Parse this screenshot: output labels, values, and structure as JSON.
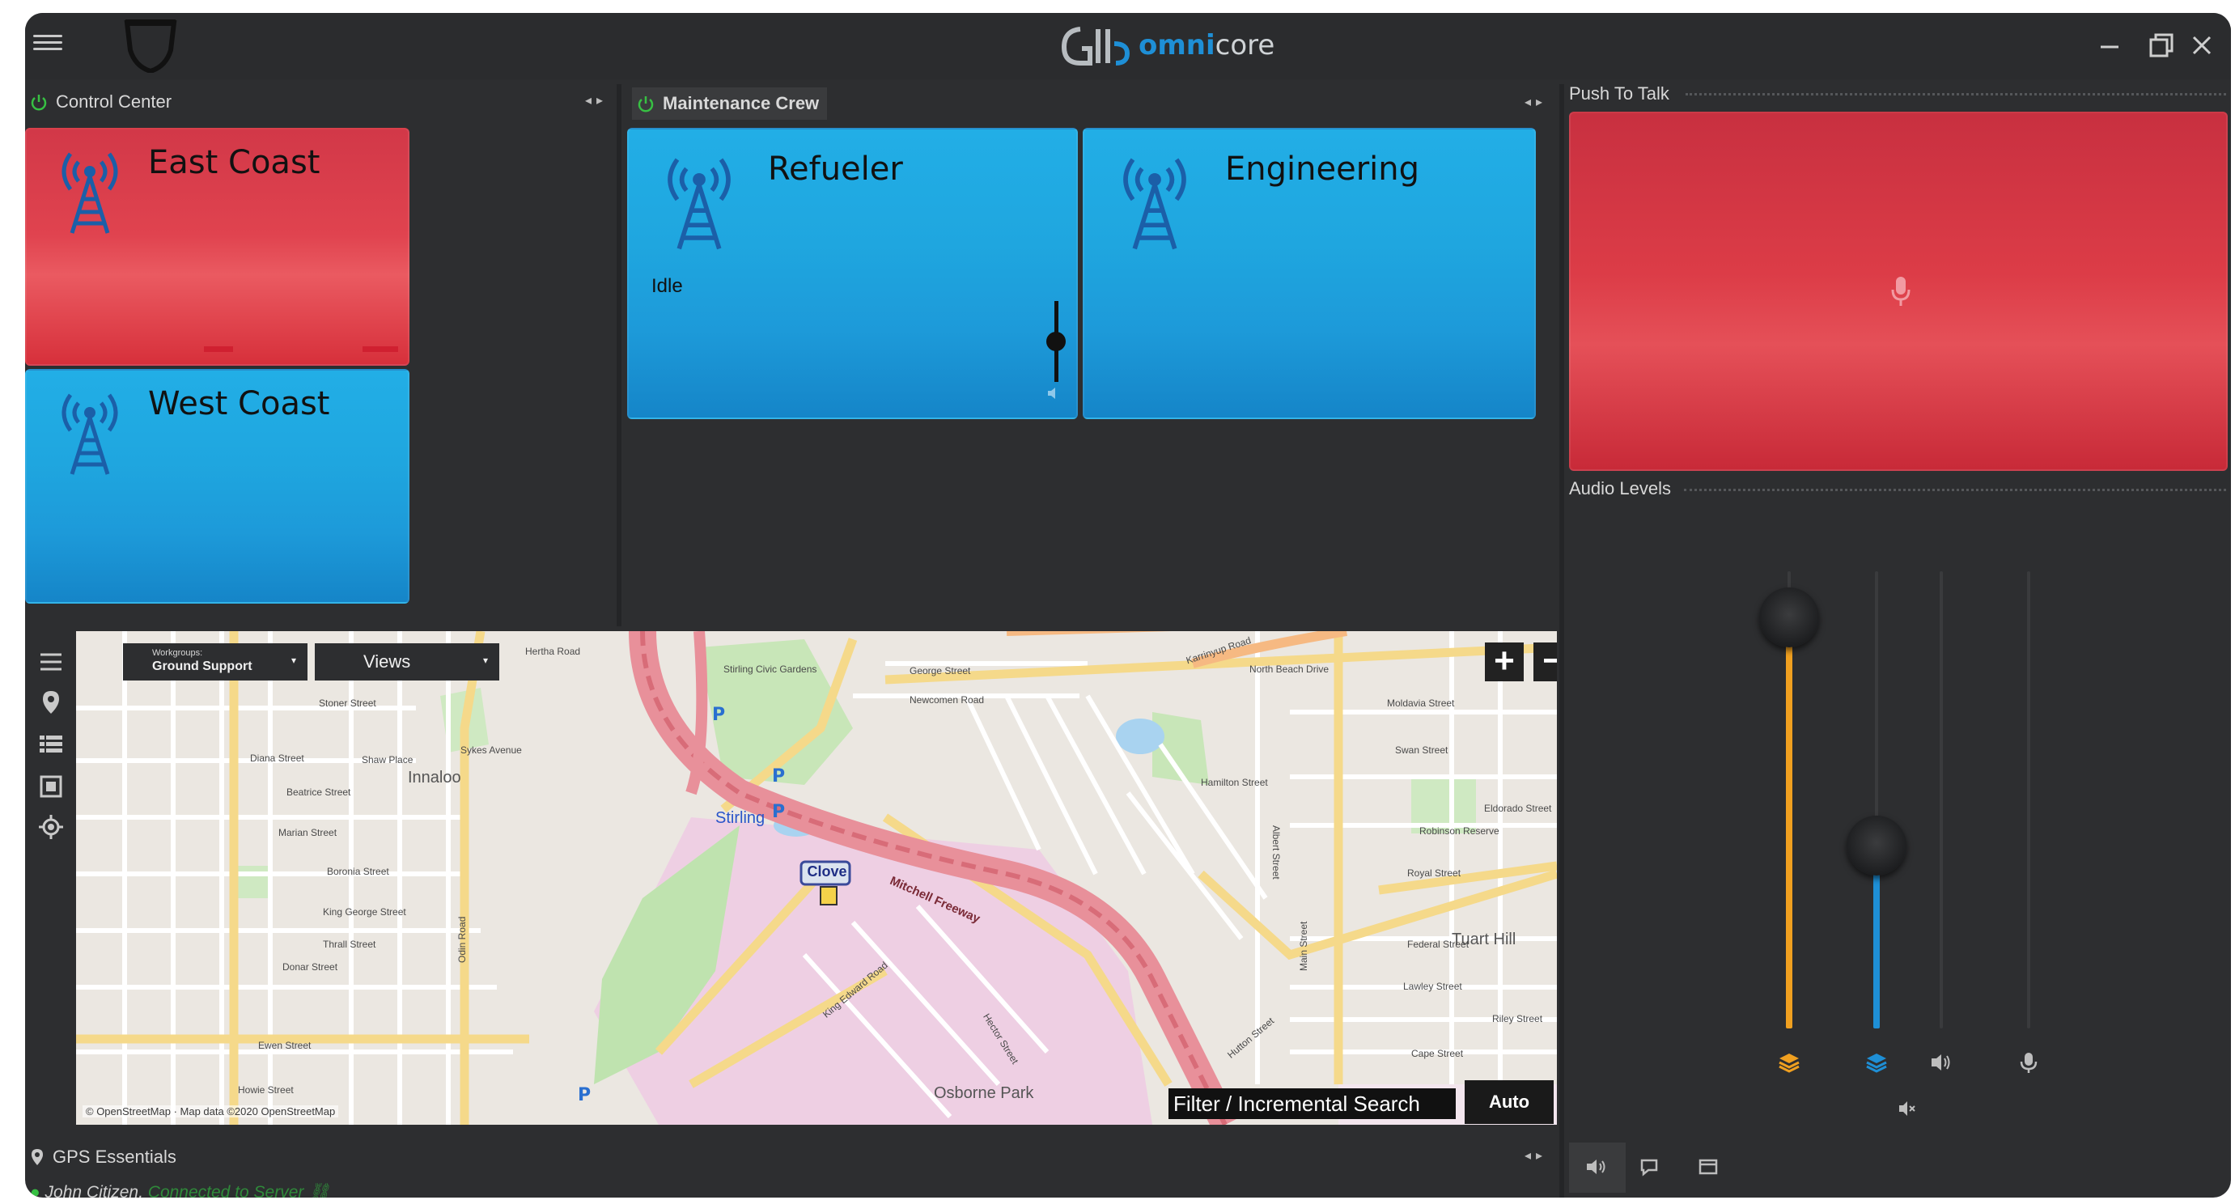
{
  "app": {
    "brand_omni": "omni",
    "brand_core": "core"
  },
  "control_center": {
    "title": "Control Center",
    "tiles": [
      {
        "label": "East Coast",
        "color": "#e0434f"
      },
      {
        "label": "West Coast",
        "color": "#1fa6df"
      }
    ]
  },
  "maintenance_crew": {
    "title": "Maintenance Crew",
    "tiles": [
      {
        "label": "Refueler",
        "status": "Idle",
        "color": "#1fa6df"
      },
      {
        "label": "Engineering",
        "color": "#1fa6df"
      }
    ]
  },
  "push_to_talk": {
    "title": "Push To Talk",
    "color": "#d23848"
  },
  "audio_levels": {
    "title": "Audio Levels",
    "sliders": [
      {
        "icon": "layers-icon",
        "color": "#f0a020",
        "level": 0.9
      },
      {
        "icon": "layers-icon",
        "color": "#1e8fd6",
        "level": 0.4
      },
      {
        "icon": "speaker-icon",
        "color": "#3a3b3d",
        "level": 0
      },
      {
        "icon": "microphone-icon",
        "color": "#3a3b3d",
        "level": 0
      }
    ]
  },
  "map": {
    "workgroups_caption": "Workgroups:",
    "workgroups_value": "Ground Support",
    "views_label": "Views",
    "search_placeholder": "Filter / Incremental Search",
    "auto_zoom": "Auto Zoom",
    "attribution": "© OpenStreetMap · Map data ©2020 OpenStreetMap",
    "marker_label": "Clove",
    "labels": [
      "Hertha Road",
      "Stirling Civic Gardens",
      "George Street",
      "North Beach Drive",
      "Newcomen Road",
      "Moldavia Street",
      "Swan Street",
      "Stoner Street",
      "Diana Street",
      "Shaw Place",
      "Innaloo",
      "Sykes Avenue",
      "Beatrice Street",
      "Marian Street",
      "Boronia Street",
      "King George Street",
      "Thrall Street",
      "Donar Street",
      "Ewen Street",
      "Howie Street",
      "Mitchell Freeway",
      "Stirling",
      "Hamilton Street",
      "Robinson Reserve",
      "Royal Street",
      "Tuart Hill",
      "Federal Street",
      "Lawley Street",
      "Riley Street",
      "Cape Street",
      "Osborne Park",
      "Hector Street",
      "King Edward Road",
      "Main Street",
      "Odin Road",
      "Hutton Street",
      "Karrinyup Road",
      "Eldorado Street",
      "Albert Street"
    ]
  },
  "gps_essentials": {
    "title": "GPS Essentials"
  },
  "footer": {
    "user": "John Citizen,",
    "status": "Connected to Server"
  }
}
